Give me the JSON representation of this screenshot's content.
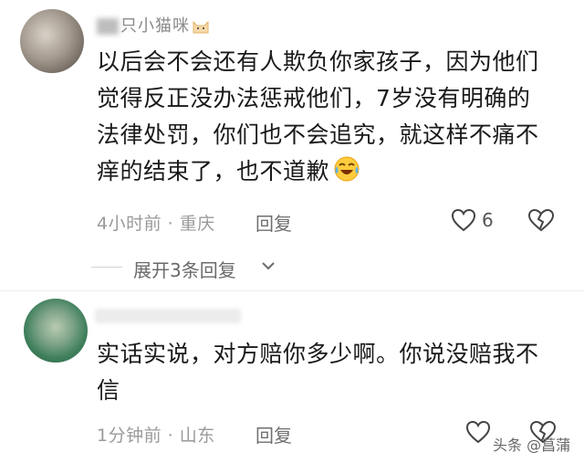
{
  "comments": [
    {
      "username_visible": "只小猫咪",
      "text_lines": [
        "以后会不会还有人欺负你家孩子，因为他们",
        "觉得反正没办法惩戒他们，7岁没有明确的",
        "法律处罚，你们也不会追究，就这样不痛不",
        "痒的结束了，也不道歉"
      ],
      "time": "4小时前",
      "location": "重庆",
      "reply_label": "回复",
      "like_count": "6",
      "icons": [
        "cat-emoji-icon",
        "laugh-cry-emoji-icon",
        "heart-icon",
        "broken-heart-icon"
      ]
    },
    {
      "username_visible": "",
      "text_lines": [
        "实话实说，对方赔你多少啊。你说没赔我不",
        "信"
      ],
      "time": "1分钟前",
      "location": "山东",
      "reply_label": "回复",
      "like_count": "",
      "icons": [
        "heart-icon",
        "broken-heart-icon"
      ]
    }
  ],
  "expand_replies": {
    "label": "展开3条回复"
  },
  "separator_dot": "·",
  "watermark": {
    "text": "头条 @菖蒲"
  },
  "colors": {
    "meta": "#9a9a9a",
    "text": "#1a1a1a",
    "background": "#ffffff"
  }
}
